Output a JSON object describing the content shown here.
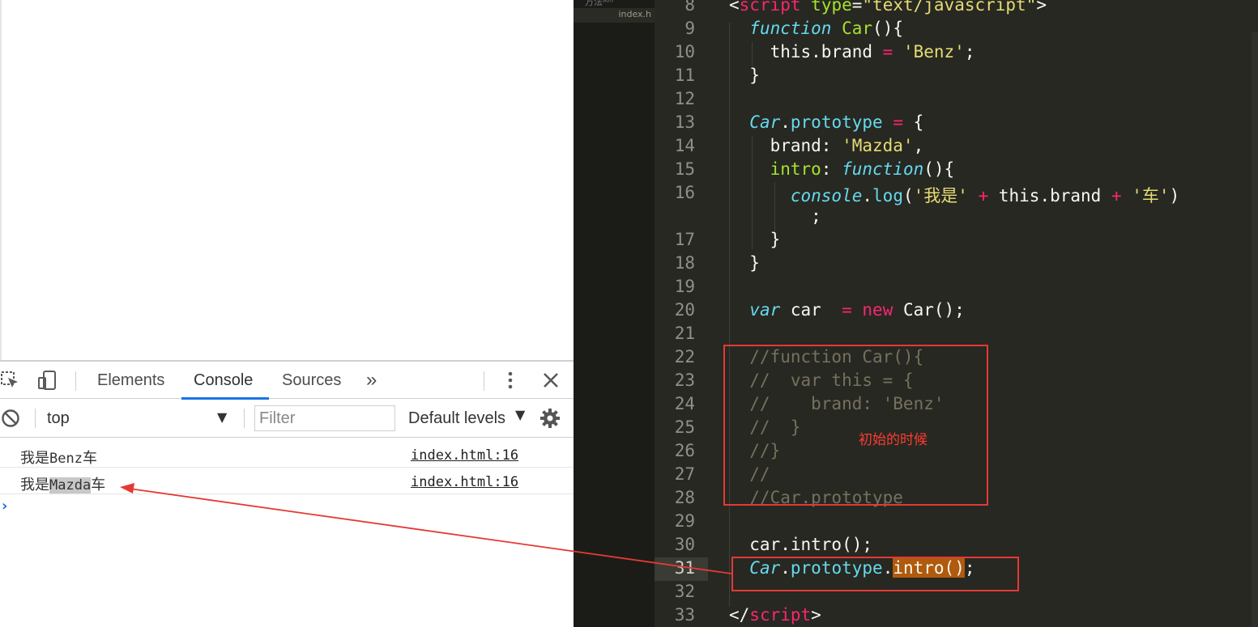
{
  "devtools": {
    "tabs": [
      "Elements",
      "Console",
      "Sources"
    ],
    "more_tabs": "»",
    "context": "top",
    "filter_placeholder": "Filter",
    "levels": "Default levels"
  },
  "console": {
    "rows": [
      {
        "prefix": "我是",
        "value": "Benz",
        "suffix": "车",
        "source": "index.html:16"
      },
      {
        "prefix": "我是",
        "value": "Mazda",
        "suffix": "车",
        "source": "index.html:16"
      }
    ],
    "prompt": "›"
  },
  "editor": {
    "sidebar_tab": "index.h",
    "sidebar_top": "万法ᵃᵒᵒ",
    "line_numbers": [
      "8",
      "9",
      "10",
      "11",
      "12",
      "13",
      "14",
      "15",
      "16",
      "",
      "17",
      "18",
      "19",
      "20",
      "21",
      "22",
      "23",
      "24",
      "25",
      "26",
      "27",
      "28",
      "29",
      "30",
      "31",
      "32",
      "33"
    ],
    "active_line": "31"
  },
  "annotation": {
    "note": "初始的时候"
  },
  "colors": {
    "editor_bg": "#272822",
    "keyword": "#f92672",
    "string": "#e6db74",
    "function": "#66d9ef",
    "comment": "#75715e",
    "annotation_red": "#e53935",
    "console_tab_accent": "#1a73e8"
  }
}
